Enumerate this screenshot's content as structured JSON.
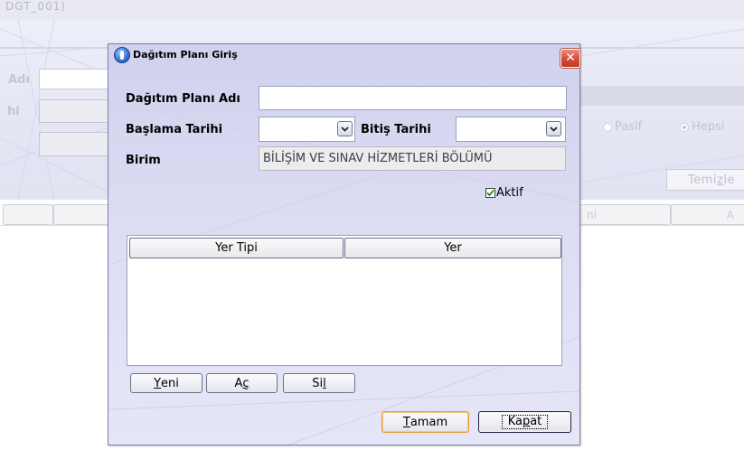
{
  "background": {
    "window_title": "DGT_001)",
    "field1_label": "Adı",
    "field2_label": "hi",
    "radio_pasif": "Pasif",
    "radio_hepsi": "Hepsi",
    "clear_button": {
      "pre": "Temi",
      "mnemonic": "z",
      "post": "le"
    },
    "column_fragment_1": "ni",
    "column_fragment_2": "A"
  },
  "dialog": {
    "title": "Dağıtım Planı Giriş",
    "close_glyph": "✕",
    "plan_name_label": "Dağıtım Planı Adı",
    "plan_name_value": "",
    "start_date_label": "Başlama Tarihi",
    "start_date_value": "",
    "end_date_label": "Bitiş Tarihi",
    "end_date_value": "",
    "unit_label": "Birim",
    "unit_value": "BİLİŞİM VE SINAV HİZMETLERİ BÖLÜMÜ",
    "active_label": "Aktif",
    "active_checked": true,
    "table": {
      "columns": [
        "Yer Tipi",
        "Yer"
      ],
      "rows": []
    },
    "buttons": {
      "new": {
        "mnemonic": "Y",
        "rest": "eni"
      },
      "open": {
        "pre": "A",
        "mnemonic": "ç",
        "post": ""
      },
      "delete": {
        "pre": "Si",
        "mnemonic": "l",
        "post": ""
      },
      "ok": {
        "mnemonic": "T",
        "rest": "amam"
      },
      "close": {
        "pre": "Ka",
        "mnemonic": "p",
        "post": "at"
      }
    }
  },
  "colors": {
    "dialog_border": "#7d80a8",
    "close_button": "#d24c38",
    "ok_button_border": "#e29d3a"
  },
  "icons": [
    "app-icon",
    "close-icon",
    "chevron-down-icon",
    "checkmark-icon"
  ]
}
